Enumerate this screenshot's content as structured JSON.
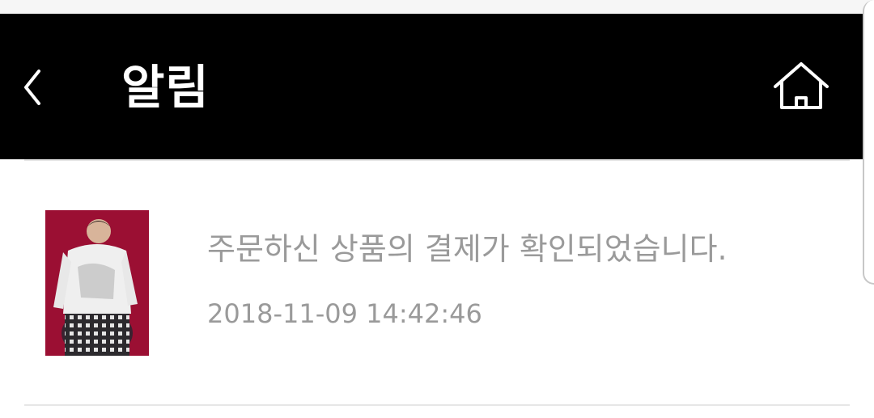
{
  "header": {
    "title": "알림",
    "back_icon": "chevron-left-icon",
    "home_icon": "home-icon",
    "background": "#000000",
    "text_color": "#ffffff"
  },
  "notifications": [
    {
      "message": "주문하신 상품의 결제가 확인되었습니다.",
      "timestamp": "2018-11-09 14:42:46",
      "thumbnail": "product-thumbnail",
      "text_color": "#9a9a9a"
    }
  ]
}
